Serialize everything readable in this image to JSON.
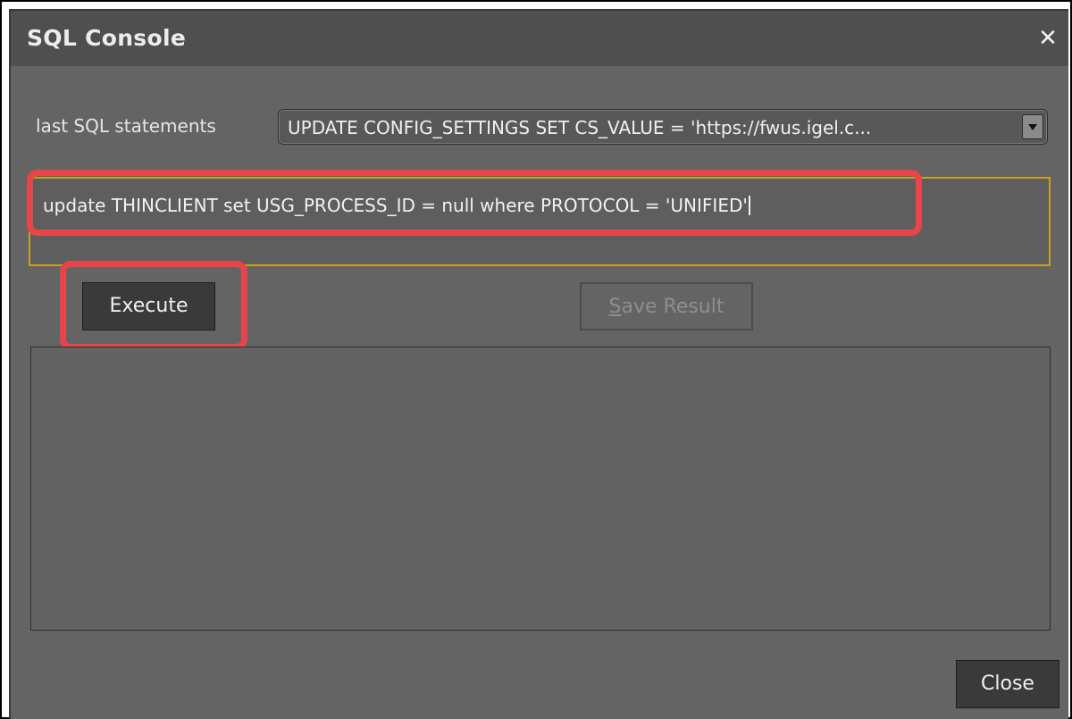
{
  "window": {
    "title": "SQL Console",
    "close_icon": "close-icon"
  },
  "history": {
    "label": "last SQL statements",
    "selected": "UPDATE CONFIG_SETTINGS SET CS_VALUE = 'https://fwus.igel.c..."
  },
  "editor": {
    "value": "update THINCLIENT set USG_PROCESS_ID = null where PROTOCOL = 'UNIFIED'"
  },
  "buttons": {
    "execute": "Execute",
    "save_result_mnemonic": "S",
    "save_result_rest": "ave Result",
    "close": "Close"
  },
  "colors": {
    "dialog_bg": "#646464",
    "titlebar_bg": "#4f4f4f",
    "highlight": "#e8454a",
    "editor_focus_border": "#c9a020"
  }
}
